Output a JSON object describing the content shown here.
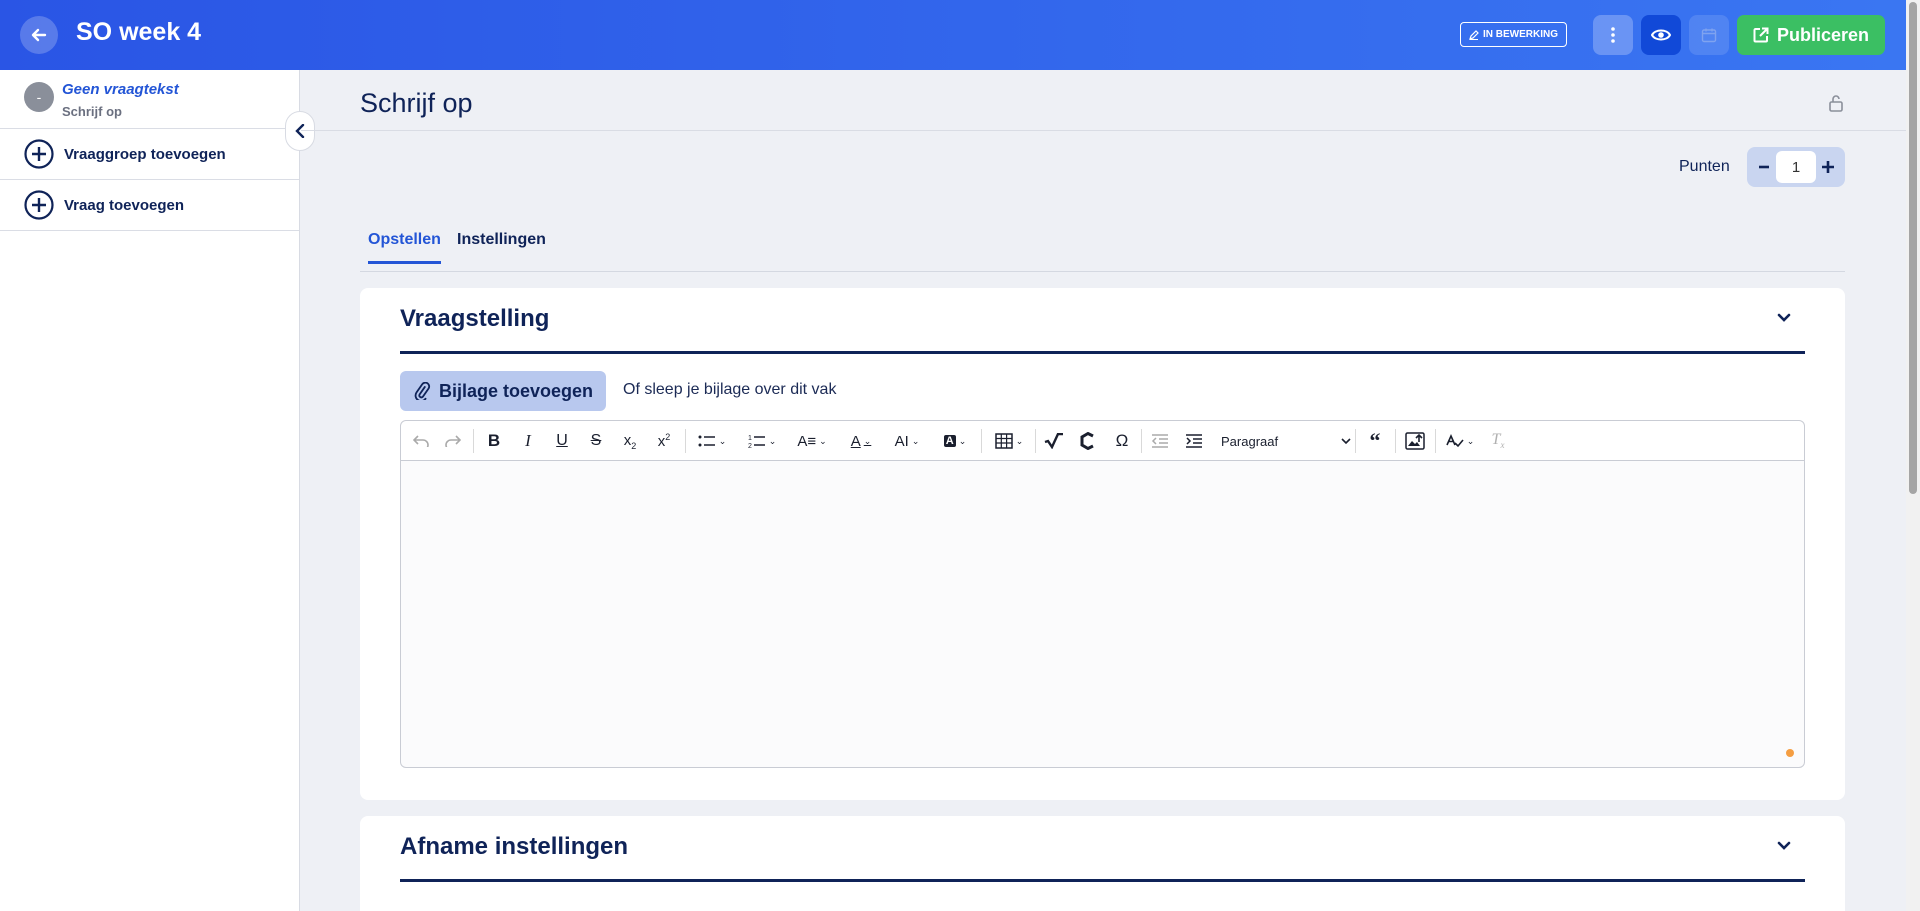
{
  "header": {
    "title": "SO week 4",
    "status_badge": "IN BEWERKING",
    "publish_label": "Publiceren"
  },
  "sidebar": {
    "question": {
      "number": "-",
      "text": "Geen vraagtekst",
      "type": "Schrijf op"
    },
    "add_group_label": "Vraaggroep toevoegen",
    "add_question_label": "Vraag toevoegen"
  },
  "main": {
    "title": "Schrijf op",
    "points_label": "Punten",
    "points_value": "1",
    "tabs": [
      {
        "label": "Opstellen",
        "active": true
      },
      {
        "label": "Instellingen",
        "active": false
      }
    ],
    "question_section": {
      "title": "Vraagstelling",
      "attach_label": "Bijlage toevoegen",
      "attach_hint": "Of sleep je bijlage over dit vak",
      "paragraph_select": "Paragraaf"
    },
    "settings_section": {
      "title": "Afname instellingen"
    }
  },
  "colors": {
    "header_start": "#2a55e5",
    "header_end": "#3a76f2",
    "publish": "#3bbf63",
    "navy": "#0f2358",
    "accent": "#2355d6"
  },
  "icons": [
    "arrow-left-icon",
    "pencil-icon",
    "more-vertical-icon",
    "eye-icon",
    "calendar-icon",
    "external-link-icon",
    "plus-circle-icon",
    "chevron-left-icon",
    "lock-open-icon",
    "chevron-down-icon",
    "paperclip-icon",
    "undo-icon",
    "redo-icon",
    "bold-icon",
    "italic-icon",
    "underline-icon",
    "strikethrough-icon",
    "subscript-icon",
    "superscript-icon",
    "bullet-list-icon",
    "numbered-list-icon",
    "text-style-icon",
    "font-color-icon",
    "font-size-icon",
    "highlight-icon",
    "table-icon",
    "math-icon",
    "chemistry-icon",
    "omega-icon",
    "outdent-icon",
    "indent-icon",
    "quote-icon",
    "image-upload-icon",
    "spellcheck-icon",
    "clear-format-icon"
  ]
}
